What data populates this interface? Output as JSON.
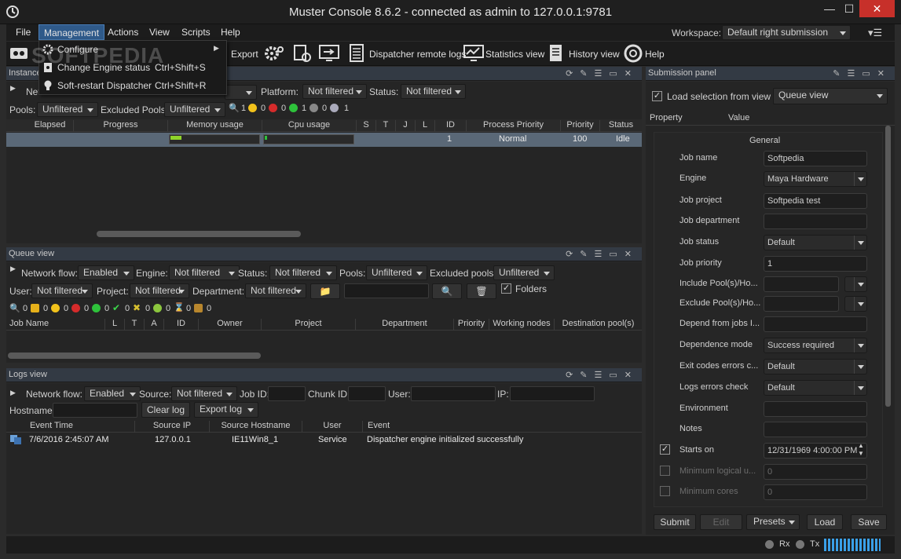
{
  "window": {
    "title": "Muster Console 8.6.2 - connected as admin to 127.0.0.1:9781",
    "minimize": "—",
    "maximize": "☐",
    "close": "✕"
  },
  "menu": {
    "file": "File",
    "management": "Management",
    "actions": "Actions",
    "view": "View",
    "scripts": "Scripts",
    "help": "Help"
  },
  "workspace": {
    "label": "Workspace:",
    "value": "Default right submission"
  },
  "management_menu": {
    "items": [
      {
        "label": "Configure",
        "shortcut": ""
      },
      {
        "label": "Change Engine status",
        "shortcut": "Ctrl+Shift+S"
      },
      {
        "label": "Soft-restart Dispatcher",
        "shortcut": "Ctrl+Shift+R"
      }
    ]
  },
  "watermark": "SOFTPEDIA",
  "toolbar": {
    "export": "Export",
    "dispatcher_logs": "Dispatcher remote logs",
    "statistics": "Statistics view",
    "history": "History view",
    "help": "Help"
  },
  "instances": {
    "title": "Instance",
    "network_label": "Net",
    "platform_label": "Platform:",
    "platform_value": "Not filtered",
    "status_label": "Status:",
    "status_value": "Not filtered",
    "pools_label": "Pools:",
    "pools_value": "Unfiltered",
    "excluded_label": "Excluded Pools:",
    "excluded_value": "Unfiltered",
    "counters": [
      "1",
      "0",
      "0",
      "1",
      "0",
      "1"
    ],
    "columns": [
      "Elapsed",
      "Progress",
      "Memory usage",
      "Cpu usage",
      "S",
      "T",
      "J",
      "L",
      "ID",
      "Process Priority",
      "Priority",
      "Status"
    ],
    "row": {
      "id": "1",
      "process_priority": "Normal",
      "priority": "100",
      "status": "Idle",
      "memory_fill": 0.12,
      "cpu_fill": 0.03
    }
  },
  "queue": {
    "title": "Queue view",
    "network_label": "Network flow:",
    "network_value": "Enabled",
    "engine_label": "Engine:",
    "engine_value": "Not filtered",
    "status_label": "Status:",
    "status_value": "Not filtered",
    "pools_label": "Pools:",
    "pools_value": "Unfiltered",
    "excluded_label": "Excluded pools:",
    "excluded_value": "Unfiltered",
    "user_label": "User:",
    "user_value": "Not filtered",
    "project_label": "Project:",
    "project_value": "Not filtered",
    "department_label": "Department:",
    "department_value": "Not filtered",
    "folders_label": "Folders",
    "counters": [
      "0",
      "0",
      "0",
      "0",
      "0",
      "0",
      "0",
      "0",
      "0",
      "0"
    ],
    "columns": [
      "Job Name",
      "L",
      "T",
      "A",
      "ID",
      "Owner",
      "Project",
      "Department",
      "Priority",
      "Working nodes",
      "Destination pool(s)"
    ]
  },
  "logs": {
    "title": "Logs view",
    "network_label": "Network flow:",
    "network_value": "Enabled",
    "source_label": "Source:",
    "source_value": "Not filtered",
    "jobid_label": "Job ID:",
    "chunkid_label": "Chunk ID:",
    "user_label": "User:",
    "ip_label": "IP:",
    "hostname_label": "Hostname:",
    "clear_label": "Clear log",
    "export_label": "Export log",
    "columns": [
      "Event Time",
      "Source IP",
      "Source Hostname",
      "User",
      "Event"
    ],
    "rows": [
      {
        "time": "7/6/2016 2:45:07 AM",
        "ip": "127.0.0.1",
        "host": "IE11Win8_1",
        "user": "Service",
        "event": "Dispatcher engine initialized successfully"
      }
    ]
  },
  "submission": {
    "title": "Submission panel",
    "load_label": "Load selection from view",
    "view_value": "Queue view",
    "property_header": "Property",
    "value_header": "Value",
    "section": "General",
    "props": [
      {
        "label": "Job name",
        "value": "Softpedia",
        "kind": "text"
      },
      {
        "label": "Engine",
        "value": "Maya Hardware",
        "kind": "combo"
      },
      {
        "label": "Job project",
        "value": "Softpedia test",
        "kind": "text"
      },
      {
        "label": "Job department",
        "value": "",
        "kind": "text"
      },
      {
        "label": "Job status",
        "value": "Default",
        "kind": "combo"
      },
      {
        "label": "Job priority",
        "value": "1",
        "kind": "text"
      },
      {
        "label": "Include Pool(s)/Ho...",
        "value": "",
        "kind": "pool"
      },
      {
        "label": "Exclude Pool(s)/Ho...",
        "value": "",
        "kind": "pool"
      },
      {
        "label": "Depend from jobs I...",
        "value": "",
        "kind": "text"
      },
      {
        "label": "Dependence mode",
        "value": "Success required",
        "kind": "combo"
      },
      {
        "label": "Exit codes errors c...",
        "value": "Default",
        "kind": "combo"
      },
      {
        "label": "Logs errors check",
        "value": "Default",
        "kind": "combo"
      },
      {
        "label": "Environment",
        "value": "",
        "kind": "text"
      },
      {
        "label": "Notes",
        "value": "",
        "kind": "text"
      },
      {
        "label": "Starts on",
        "value": "12/31/1969 4:00:00 PM",
        "kind": "spin"
      },
      {
        "label": "Minimum logical u...",
        "value": "0",
        "kind": "dimtext"
      },
      {
        "label": "Minimum cores",
        "value": "0",
        "kind": "dimtext"
      }
    ],
    "buttons": {
      "submit": "Submit",
      "edit": "Edit",
      "presets": "Presets",
      "load": "Load",
      "save": "Save"
    }
  },
  "statusbar": {
    "rx": "Rx",
    "tx": "Tx"
  }
}
